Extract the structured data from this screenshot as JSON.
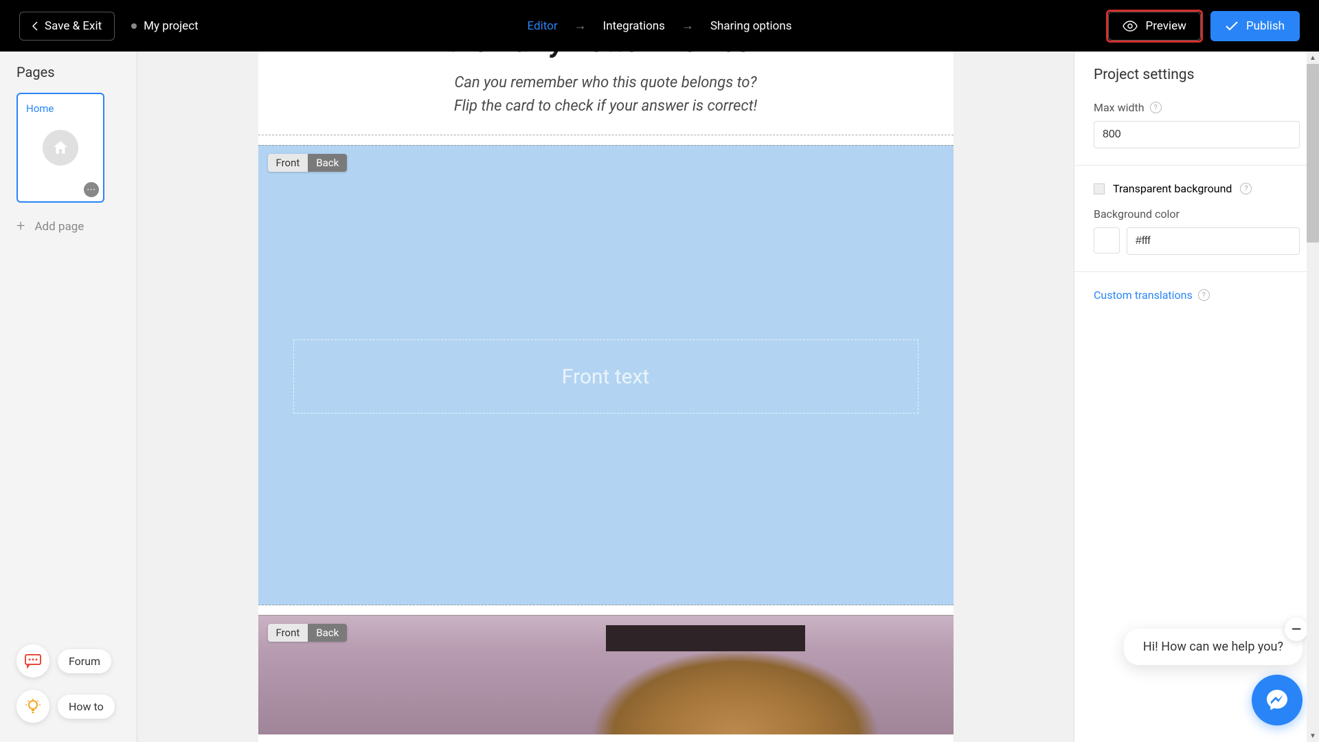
{
  "topnav": {
    "save_exit": "Save & Exit",
    "project_name": "My project",
    "editor": "Editor",
    "integrations": "Integrations",
    "sharing": "Sharing options",
    "preview": "Preview",
    "publish": "Publish"
  },
  "sidebar": {
    "pages_title": "Pages",
    "home_label": "Home",
    "add_page": "Add page",
    "forum": "Forum",
    "howto": "How to"
  },
  "canvas": {
    "heading_prefix": "the ",
    "heading_italic": "Harry Potter",
    "heading_suffix": " movies?",
    "subtitle_line1": "Can you remember who this quote belongs to?",
    "subtitle_line2": "Flip the card to check if your answer is correct!",
    "tab_front": "Front",
    "tab_back": "Back",
    "front_text_placeholder": "Front text"
  },
  "settings": {
    "title": "Project settings",
    "max_width_label": "Max width",
    "max_width_value": "800",
    "transparent_bg": "Transparent background",
    "bg_color_label": "Background color",
    "bg_color_value": "#fff",
    "custom_translations": "Custom translations"
  },
  "chat": {
    "greeting": "Hi! How can we help you?"
  }
}
